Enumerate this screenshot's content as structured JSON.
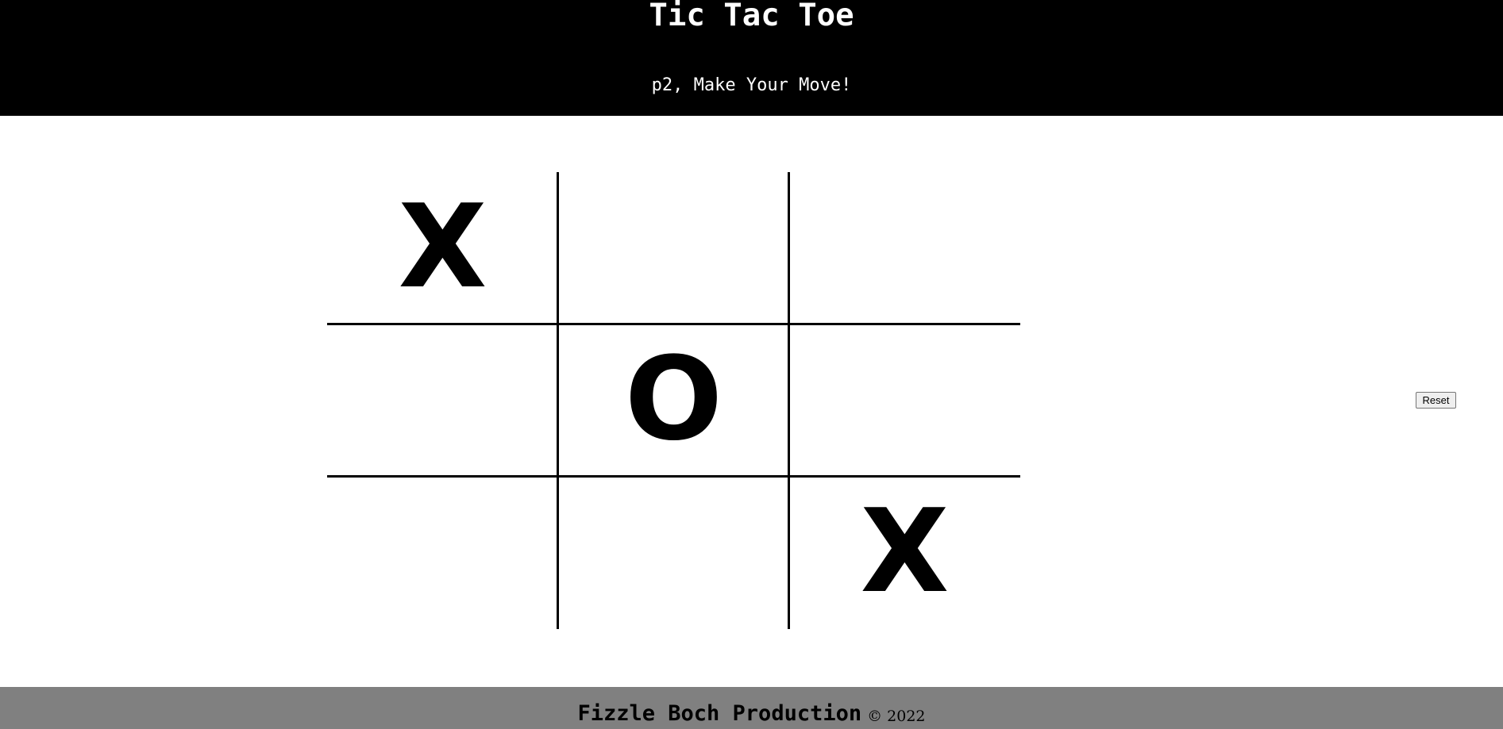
{
  "header": {
    "title": "Tic Tac Toe",
    "status": "p2, Make Your Move!"
  },
  "board": {
    "cells": [
      "X",
      "",
      "",
      "",
      "O",
      "",
      "",
      "",
      "X"
    ]
  },
  "controls": {
    "reset_label": "Reset"
  },
  "footer": {
    "name": "Fizzle Boch Production",
    "copyright": "© 2022"
  },
  "colors": {
    "header_bg": "#000000",
    "header_text": "#ffffff",
    "footer_bg": "#808080",
    "mark": "#000000"
  }
}
